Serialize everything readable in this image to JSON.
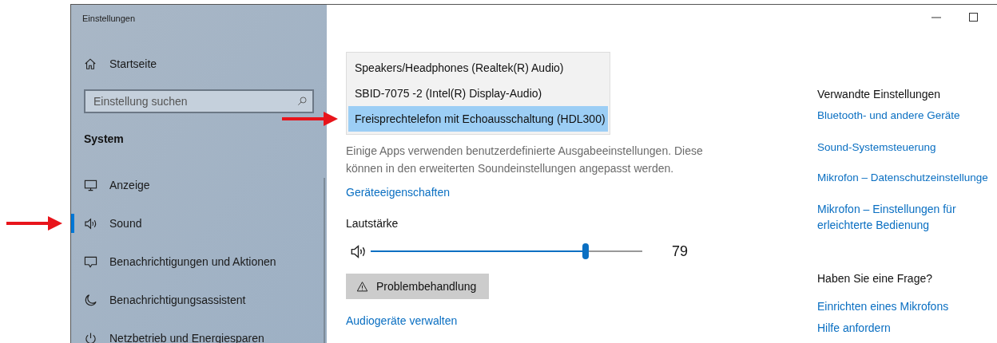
{
  "window": {
    "title": "Einstellungen"
  },
  "sidebar": {
    "home": {
      "label": "Startseite"
    },
    "search": {
      "placeholder": "Einstellung suchen"
    },
    "section": "System",
    "items": [
      {
        "label": "Anzeige",
        "kind": "display",
        "selected": false,
        "marked": false
      },
      {
        "label": "Sound",
        "kind": "speaker",
        "selected": true,
        "marked": true
      },
      {
        "label": "Benachrichtigungen und Aktionen",
        "kind": "message",
        "selected": false,
        "marked": false
      },
      {
        "label": "Benachrichtigungsassistent",
        "kind": "moon",
        "selected": false,
        "marked": false
      },
      {
        "label": "Netzbetrieb und Energiesparen",
        "kind": "power",
        "selected": false,
        "marked": false
      }
    ]
  },
  "devices": [
    {
      "label": "Speakers/Headphones (Realtek(R) Audio)",
      "selected": false,
      "marked": false
    },
    {
      "label": "SBID-7075 -2 (Intel(R) Display-Audio)",
      "selected": false,
      "marked": false
    },
    {
      "label": "Freisprechtelefon mit Echoausschaltung (HDL300)",
      "selected": true,
      "marked": true
    }
  ],
  "note": "Einige Apps verwenden benutzerdefinierte Ausgabeeinstellungen. Diese können in den erweiterten Soundeinstellungen angepasst werden.",
  "properties_link": "Geräteeigenschaften",
  "volume": {
    "label": "Lautstärke",
    "level": 0.79,
    "reading": "79"
  },
  "troubleshoot_button": "Problembehandlung",
  "manage_link": "Audiogeräte verwalten",
  "related": {
    "heading": "Verwandte Einstellungen",
    "links": [
      "Bluetooth- und andere Geräte",
      "Sound-Systemsteuerung",
      "Mikrofon – Datenschutzeinstellunge",
      "Mikrofon – Einstellungen für erleichterte Bedienung"
    ]
  },
  "help": {
    "heading": "Haben Sie eine Frage?",
    "links": [
      "Einrichten eines Mikrofons",
      "Hilfe anfordern"
    ]
  }
}
